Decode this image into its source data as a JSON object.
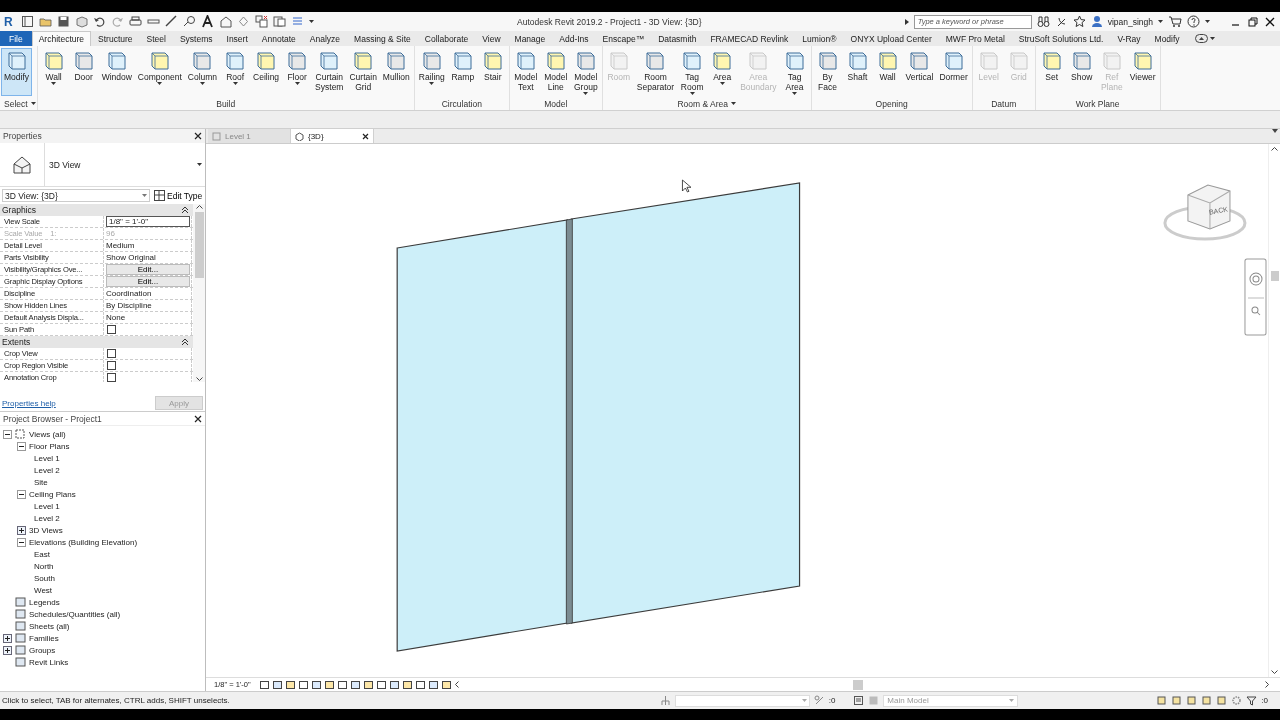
{
  "app_logo": "R",
  "title": "Autodesk Revit 2019.2 - Project1 - 3D View: {3D}",
  "search": {
    "placeholder": "Type a keyword or phrase"
  },
  "user": "vipan_singh",
  "tabs": [
    {
      "label": "File",
      "kind": "file",
      "selected": false
    },
    {
      "label": "Architecture",
      "kind": "tab",
      "selected": true
    },
    {
      "label": "Structure",
      "kind": "tab",
      "selected": false
    },
    {
      "label": "Steel",
      "kind": "tab",
      "selected": false
    },
    {
      "label": "Systems",
      "kind": "tab",
      "selected": false
    },
    {
      "label": "Insert",
      "kind": "tab",
      "selected": false
    },
    {
      "label": "Annotate",
      "kind": "tab",
      "selected": false
    },
    {
      "label": "Analyze",
      "kind": "tab",
      "selected": false
    },
    {
      "label": "Massing & Site",
      "kind": "tab",
      "selected": false
    },
    {
      "label": "Collaborate",
      "kind": "tab",
      "selected": false
    },
    {
      "label": "View",
      "kind": "tab",
      "selected": false
    },
    {
      "label": "Manage",
      "kind": "tab",
      "selected": false
    },
    {
      "label": "Add-Ins",
      "kind": "tab",
      "selected": false
    },
    {
      "label": "Enscape™",
      "kind": "tab",
      "selected": false
    },
    {
      "label": "Datasmith",
      "kind": "tab",
      "selected": false
    },
    {
      "label": "FRAMECAD Revlink",
      "kind": "tab",
      "selected": false
    },
    {
      "label": "Lumion®",
      "kind": "tab",
      "selected": false
    },
    {
      "label": "ONYX Upload Center",
      "kind": "tab",
      "selected": false
    },
    {
      "label": "MWF Pro Metal",
      "kind": "tab",
      "selected": false
    },
    {
      "label": "StruSoft Solutions Ltd.",
      "kind": "tab",
      "selected": false
    },
    {
      "label": "V-Ray",
      "kind": "tab",
      "selected": false
    },
    {
      "label": "Modify",
      "kind": "tab",
      "selected": false
    }
  ],
  "ribbon": [
    {
      "title": "Select",
      "menu": true,
      "tools": [
        {
          "label": "Modify",
          "selected": true,
          "disabled": false,
          "dropdown": false
        }
      ]
    },
    {
      "title": "Build",
      "menu": false,
      "tools": [
        {
          "label": "Wall",
          "selected": false,
          "disabled": false,
          "dropdown": true
        },
        {
          "label": "Door",
          "selected": false,
          "disabled": false,
          "dropdown": false
        },
        {
          "label": "Window",
          "selected": false,
          "disabled": false,
          "dropdown": false
        },
        {
          "label": "Component",
          "selected": false,
          "disabled": false,
          "dropdown": true
        },
        {
          "label": "Column",
          "selected": false,
          "disabled": false,
          "dropdown": true
        },
        {
          "label": "Roof",
          "selected": false,
          "disabled": false,
          "dropdown": true
        },
        {
          "label": "Ceiling",
          "selected": false,
          "disabled": false,
          "dropdown": false
        },
        {
          "label": "Floor",
          "selected": false,
          "disabled": false,
          "dropdown": true
        },
        {
          "label": "Curtain\nSystem",
          "selected": false,
          "disabled": false,
          "dropdown": false
        },
        {
          "label": "Curtain\nGrid",
          "selected": false,
          "disabled": false,
          "dropdown": false
        },
        {
          "label": "Mullion",
          "selected": false,
          "disabled": false,
          "dropdown": false
        }
      ]
    },
    {
      "title": "Circulation",
      "menu": false,
      "tools": [
        {
          "label": "Railing",
          "selected": false,
          "disabled": false,
          "dropdown": true
        },
        {
          "label": "Ramp",
          "selected": false,
          "disabled": false,
          "dropdown": false
        },
        {
          "label": "Stair",
          "selected": false,
          "disabled": false,
          "dropdown": false
        }
      ]
    },
    {
      "title": "Model",
      "menu": false,
      "tools": [
        {
          "label": "Model\nText",
          "selected": false,
          "disabled": false,
          "dropdown": false
        },
        {
          "label": "Model\nLine",
          "selected": false,
          "disabled": false,
          "dropdown": false
        },
        {
          "label": "Model\nGroup",
          "selected": false,
          "disabled": false,
          "dropdown": true
        }
      ]
    },
    {
      "title": "Room & Area",
      "menu": true,
      "tools": [
        {
          "label": "Room",
          "selected": false,
          "disabled": true,
          "dropdown": false
        },
        {
          "label": "Room\nSeparator",
          "selected": false,
          "disabled": false,
          "dropdown": false
        },
        {
          "label": "Tag\nRoom",
          "selected": false,
          "disabled": false,
          "dropdown": true
        },
        {
          "label": "Area",
          "selected": false,
          "disabled": false,
          "dropdown": true
        },
        {
          "label": "Area\nBoundary",
          "selected": false,
          "disabled": true,
          "dropdown": false
        },
        {
          "label": "Tag\nArea",
          "selected": false,
          "disabled": false,
          "dropdown": true
        }
      ]
    },
    {
      "title": "Opening",
      "menu": false,
      "tools": [
        {
          "label": "By\nFace",
          "selected": false,
          "disabled": false,
          "dropdown": false
        },
        {
          "label": "Shaft",
          "selected": false,
          "disabled": false,
          "dropdown": false
        },
        {
          "label": "Wall",
          "selected": false,
          "disabled": false,
          "dropdown": false
        },
        {
          "label": "Vertical",
          "selected": false,
          "disabled": false,
          "dropdown": false
        },
        {
          "label": "Dormer",
          "selected": false,
          "disabled": false,
          "dropdown": false
        }
      ]
    },
    {
      "title": "Datum",
      "menu": false,
      "tools": [
        {
          "label": "Level",
          "selected": false,
          "disabled": true,
          "dropdown": false
        },
        {
          "label": "Grid",
          "selected": false,
          "disabled": true,
          "dropdown": false
        }
      ]
    },
    {
      "title": "Work Plane",
      "menu": false,
      "tools": [
        {
          "label": "Set",
          "selected": false,
          "disabled": false,
          "dropdown": false
        },
        {
          "label": "Show",
          "selected": false,
          "disabled": false,
          "dropdown": false
        },
        {
          "label": "Ref\nPlane",
          "selected": false,
          "disabled": true,
          "dropdown": false
        },
        {
          "label": "Viewer",
          "selected": false,
          "disabled": false,
          "dropdown": false
        }
      ]
    }
  ],
  "view_tabs": [
    {
      "label": "Level 1",
      "selected": false
    },
    {
      "label": "{3D}",
      "selected": true
    }
  ],
  "properties": {
    "title": "Properties",
    "type": "3D View",
    "selector": "3D View: {3D}",
    "edit_type": "Edit Type",
    "groups": [
      {
        "name": "Graphics",
        "rows": [
          {
            "label": "View Scale",
            "value": "1/8\" = 1'-0\"",
            "kind": "field",
            "disabled": false
          },
          {
            "label": "Scale Value    1:",
            "value": "96",
            "kind": "text",
            "disabled": true
          },
          {
            "label": "Detail Level",
            "value": "Medium",
            "kind": "text",
            "disabled": false
          },
          {
            "label": "Parts Visibility",
            "value": "Show Original",
            "kind": "text",
            "disabled": false
          },
          {
            "label": "Visibility/Graphics Ove...",
            "value": "Edit...",
            "kind": "button",
            "disabled": false
          },
          {
            "label": "Graphic Display Options",
            "value": "Edit...",
            "kind": "button",
            "disabled": false
          },
          {
            "label": "Discipline",
            "value": "Coordination",
            "kind": "text",
            "disabled": false
          },
          {
            "label": "Show Hidden Lines",
            "value": "By Discipline",
            "kind": "text",
            "disabled": false
          },
          {
            "label": "Default Analysis Displa...",
            "value": "None",
            "kind": "text",
            "disabled": false
          },
          {
            "label": "Sun Path",
            "kind": "checkbox",
            "checked": false,
            "disabled": false
          }
        ]
      },
      {
        "name": "Extents",
        "rows": [
          {
            "label": "Crop View",
            "kind": "checkbox",
            "checked": false,
            "disabled": false
          },
          {
            "label": "Crop Region Visible",
            "kind": "checkbox",
            "checked": false,
            "disabled": false
          },
          {
            "label": "Annotation Crop",
            "kind": "checkbox",
            "checked": false,
            "disabled": false
          }
        ]
      }
    ],
    "help": "Properties help",
    "apply": "Apply"
  },
  "browser": {
    "title": "Project Browser - Project1",
    "tree": [
      {
        "label": "Views (all)",
        "kind": "group",
        "expanded": true,
        "children": [
          {
            "label": "Floor Plans",
            "kind": "group",
            "expanded": true,
            "children": [
              {
                "label": "Level 1",
                "kind": "view"
              },
              {
                "label": "Level 2",
                "kind": "view"
              },
              {
                "label": "Site",
                "kind": "view"
              }
            ]
          },
          {
            "label": "Ceiling Plans",
            "kind": "group",
            "expanded": true,
            "children": [
              {
                "label": "Level 1",
                "kind": "view"
              },
              {
                "label": "Level 2",
                "kind": "view"
              }
            ]
          },
          {
            "label": "3D Views",
            "kind": "group",
            "expanded": false
          },
          {
            "label": "Elevations (Building Elevation)",
            "kind": "group",
            "expanded": true,
            "children": [
              {
                "label": "East",
                "kind": "view"
              },
              {
                "label": "North",
                "kind": "view"
              },
              {
                "label": "South",
                "kind": "view"
              },
              {
                "label": "West",
                "kind": "view"
              }
            ]
          }
        ]
      },
      {
        "label": "Legends",
        "kind": "category"
      },
      {
        "label": "Schedules/Quantities (all)",
        "kind": "category"
      },
      {
        "label": "Sheets (all)",
        "kind": "category"
      },
      {
        "label": "Families",
        "kind": "group",
        "expanded": false
      },
      {
        "label": "Groups",
        "kind": "group",
        "expanded": false
      },
      {
        "label": "Revit Links",
        "kind": "category"
      }
    ]
  },
  "viewcube": {
    "face": "BACK"
  },
  "view_scale": "1/8\" = 1'-0\"",
  "status": {
    "message": "Click to select, TAB for alternates, CTRL adds, SHIFT unselects.",
    "count": ":0",
    "model": "Main Model",
    "filter_count": ":0"
  }
}
